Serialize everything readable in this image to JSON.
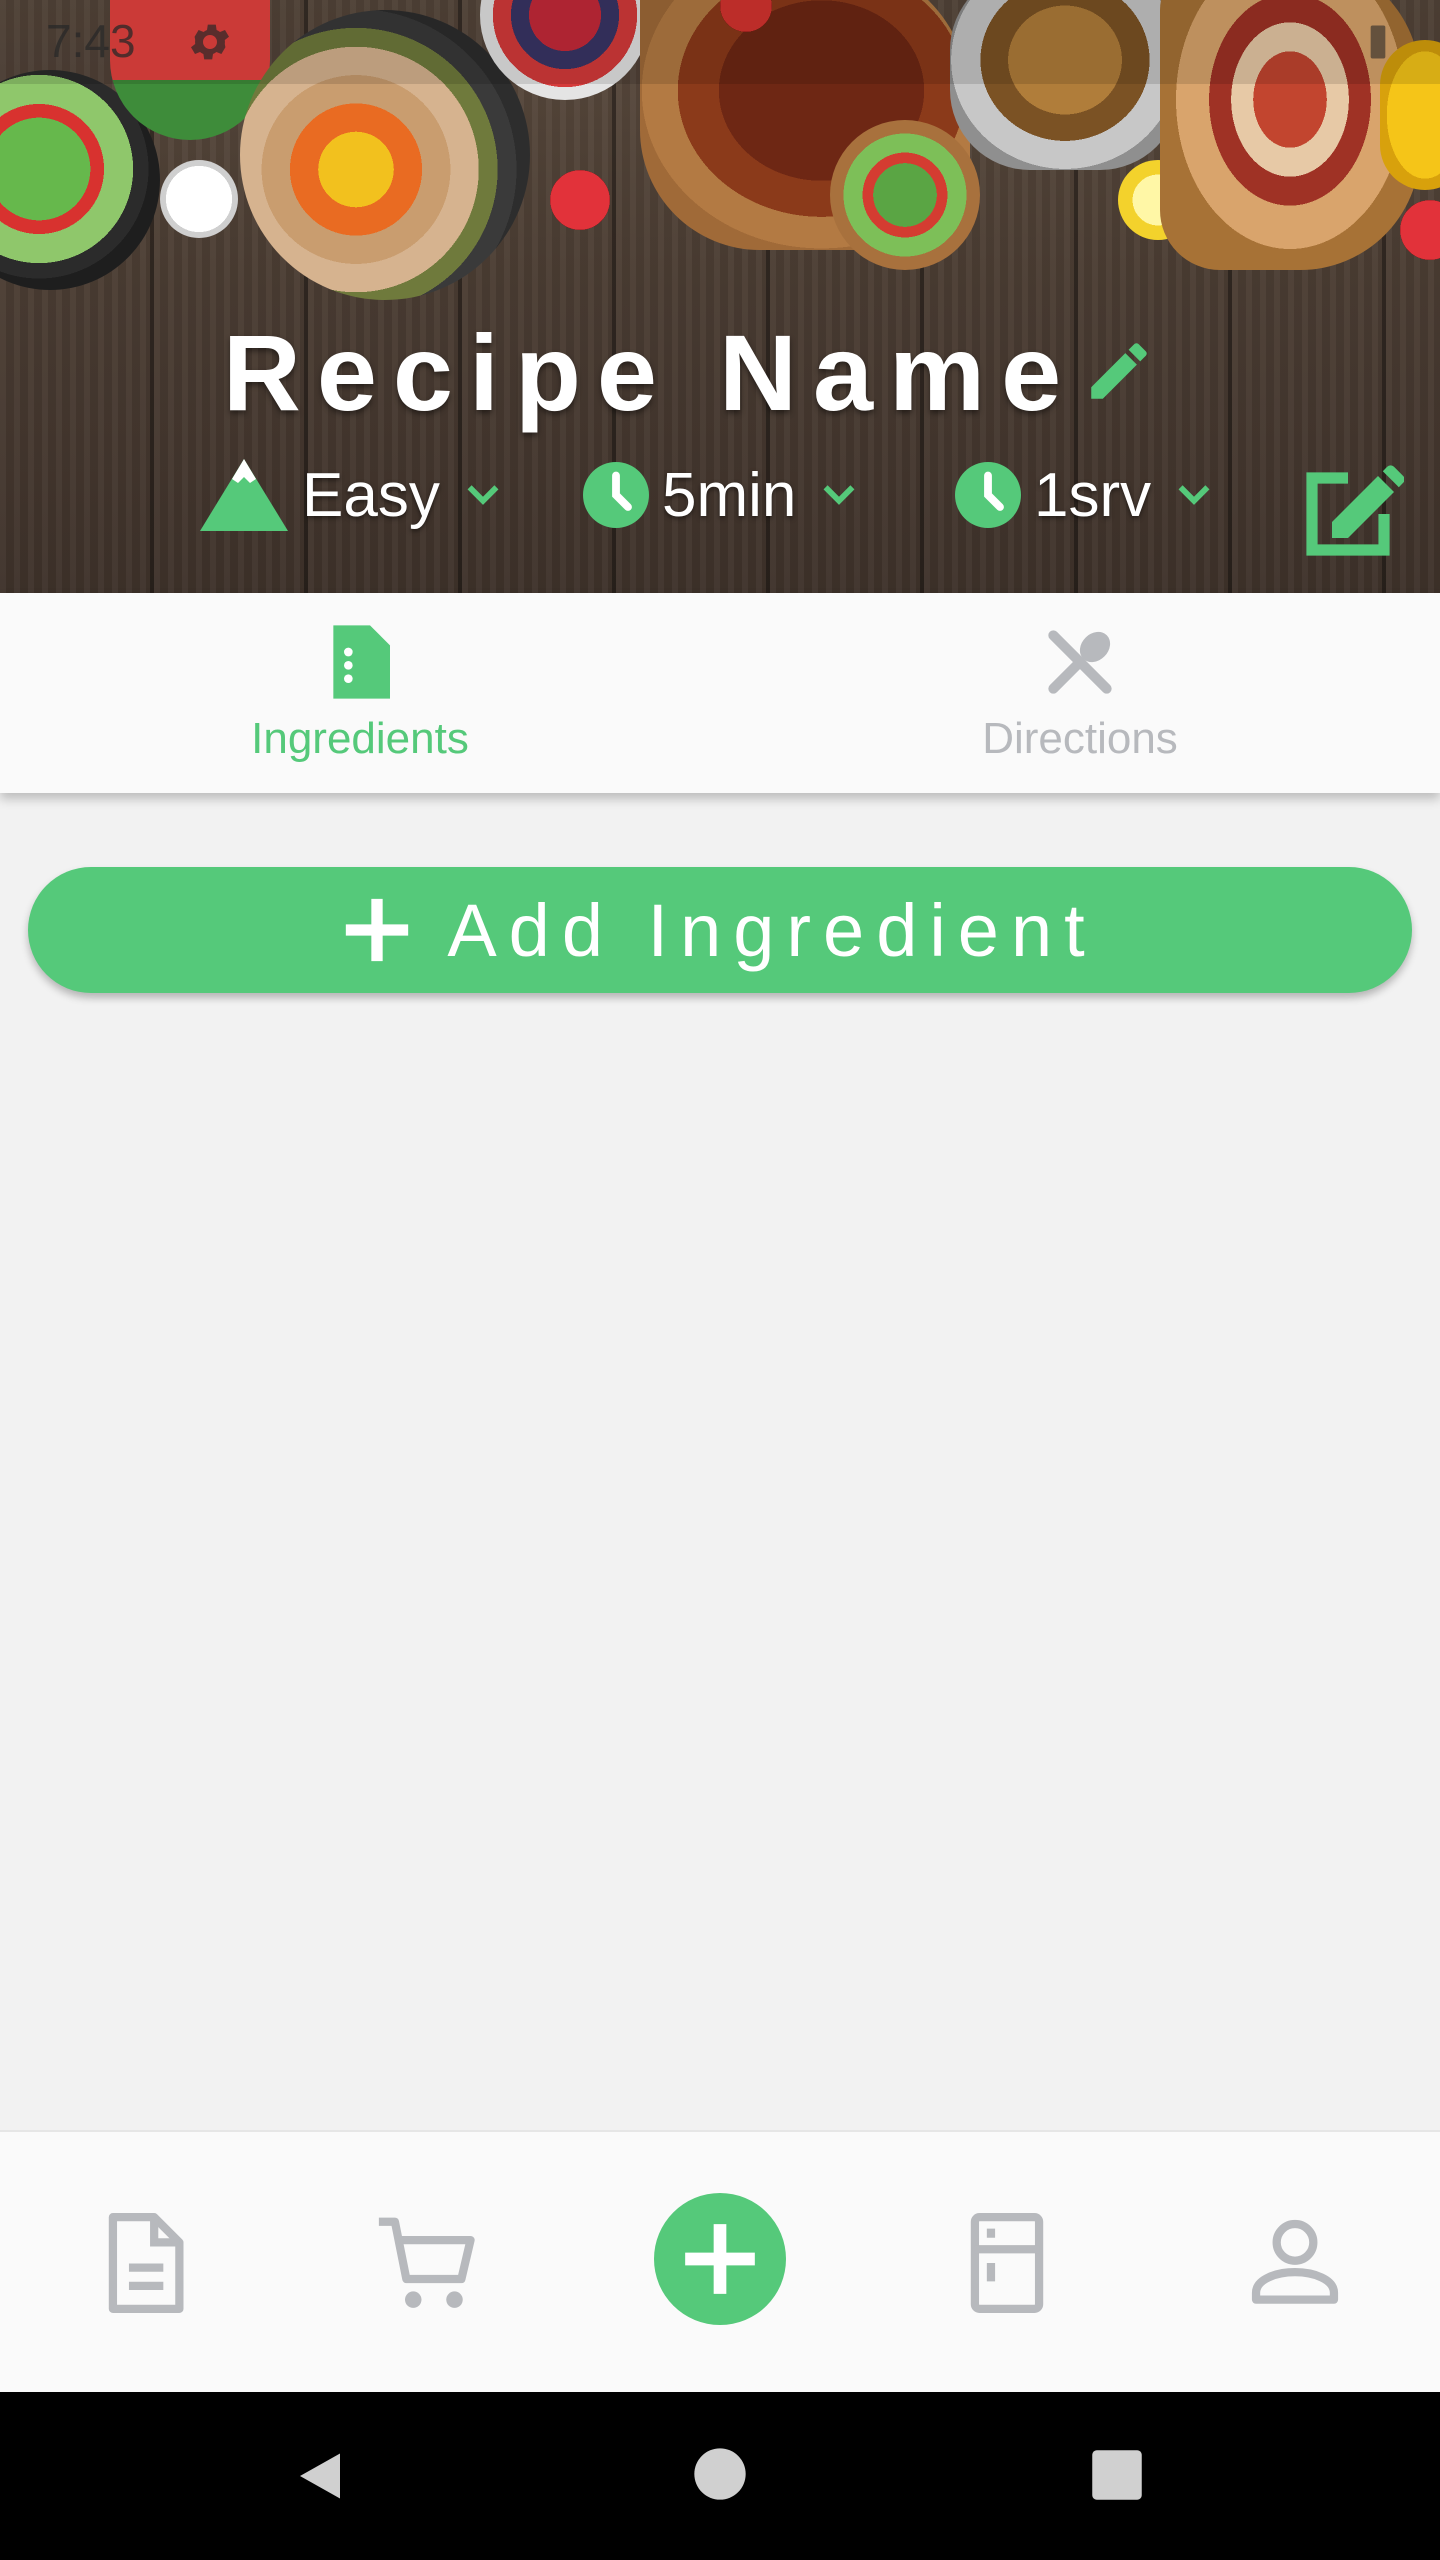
{
  "status_bar": {
    "time": "7:43"
  },
  "header": {
    "recipe_title": "Recipe Name",
    "difficulty": "Easy",
    "time": "5min",
    "servings": "1srv"
  },
  "tabs": [
    {
      "label": "Ingredients",
      "icon": "document-icon",
      "active": true
    },
    {
      "label": "Directions",
      "icon": "utensils-icon",
      "active": false
    }
  ],
  "content": {
    "add_button_label": "Add Ingredient"
  },
  "bottom_nav": [
    {
      "icon": "document-outline-icon"
    },
    {
      "icon": "cart-icon"
    },
    {
      "icon": "plus-circle-icon"
    },
    {
      "icon": "fridge-icon"
    },
    {
      "icon": "person-icon"
    }
  ],
  "colors": {
    "accent": "#55c97a",
    "inactive": "#b7b9bd",
    "background": "#f2f2f2",
    "surface": "#fafafa"
  }
}
